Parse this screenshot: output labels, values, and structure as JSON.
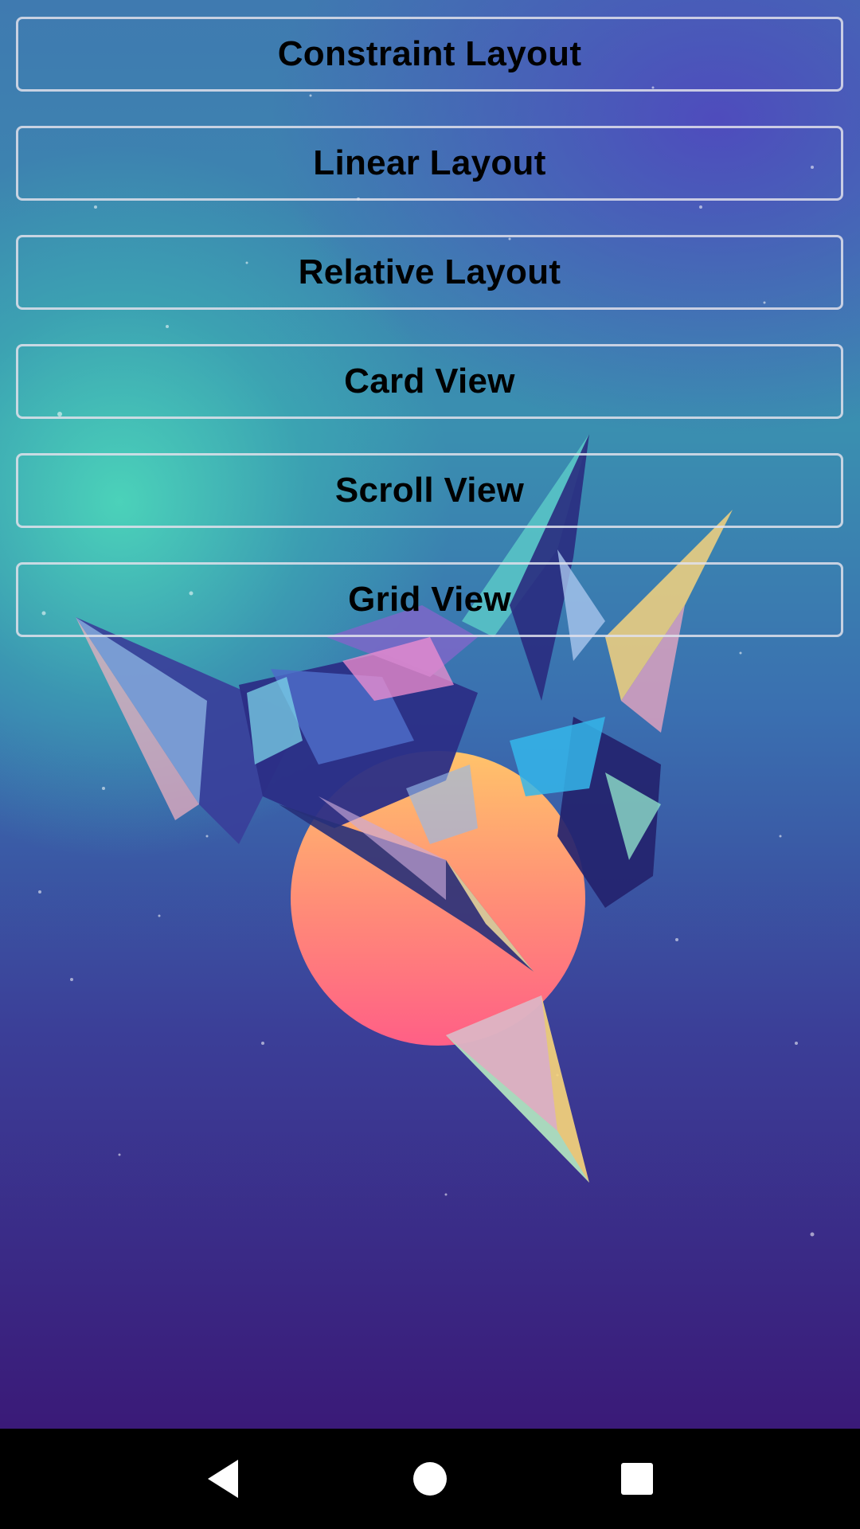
{
  "buttons": [
    {
      "label": "Constraint Layout"
    },
    {
      "label": "Linear Layout"
    },
    {
      "label": "Relative Layout"
    },
    {
      "label": "Card View"
    },
    {
      "label": "Scroll View"
    },
    {
      "label": "Grid View"
    }
  ],
  "navigation": {
    "back_icon": "back-triangle-icon",
    "home_icon": "home-circle-icon",
    "recents_icon": "recents-square-icon"
  },
  "colors": {
    "navbar": "#000000",
    "button_border": "#e1e1eb",
    "button_text": "#000000"
  }
}
